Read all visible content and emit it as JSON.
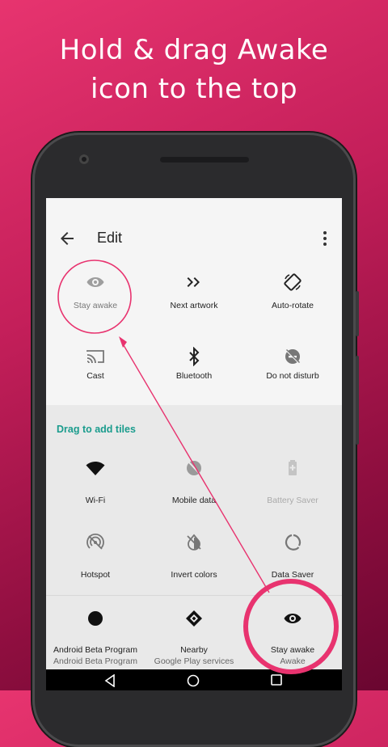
{
  "headline": {
    "line1": "Hold & drag Awake",
    "line2": "icon to the top"
  },
  "appbar": {
    "title": "Edit",
    "back_icon": "arrow-back-icon",
    "more_icon": "more-vert-icon"
  },
  "active_tiles": [
    {
      "label": "Stay awake",
      "icon": "eye-icon"
    },
    {
      "label": "Next artwork",
      "icon": "fast-forward-icon"
    },
    {
      "label": "Auto-rotate",
      "icon": "screen-rotation-icon"
    },
    {
      "label": "Cast",
      "icon": "cast-icon"
    },
    {
      "label": "Bluetooth",
      "icon": "bluetooth-icon"
    },
    {
      "label": "Do not disturb",
      "icon": "do-not-disturb-icon"
    }
  ],
  "drag_label": "Drag to add tiles",
  "available_tiles": [
    {
      "label": "Wi-Fi",
      "icon": "wifi-icon"
    },
    {
      "label": "Mobile data",
      "icon": "mobile-data-off-icon"
    },
    {
      "label": "Battery Saver",
      "icon": "battery-saver-icon"
    },
    {
      "label": "Hotspot",
      "icon": "hotspot-icon"
    },
    {
      "label": "Invert colors",
      "icon": "invert-colors-icon"
    },
    {
      "label": "Data Saver",
      "icon": "data-saver-icon"
    },
    {
      "label": "Android Beta Program",
      "sub": "Android Beta Program",
      "icon": "circle-icon"
    },
    {
      "label": "Nearby",
      "sub": "Google Play services",
      "icon": "nearby-icon"
    },
    {
      "label": "Stay awake",
      "sub": "Awake",
      "icon": "eye-icon"
    }
  ],
  "navbar": {
    "back_icon": "nav-back-icon",
    "home_icon": "nav-home-icon",
    "recents_icon": "nav-recents-icon"
  },
  "colors": {
    "accent": "#1a9c8d",
    "highlight": "#e8336f"
  }
}
